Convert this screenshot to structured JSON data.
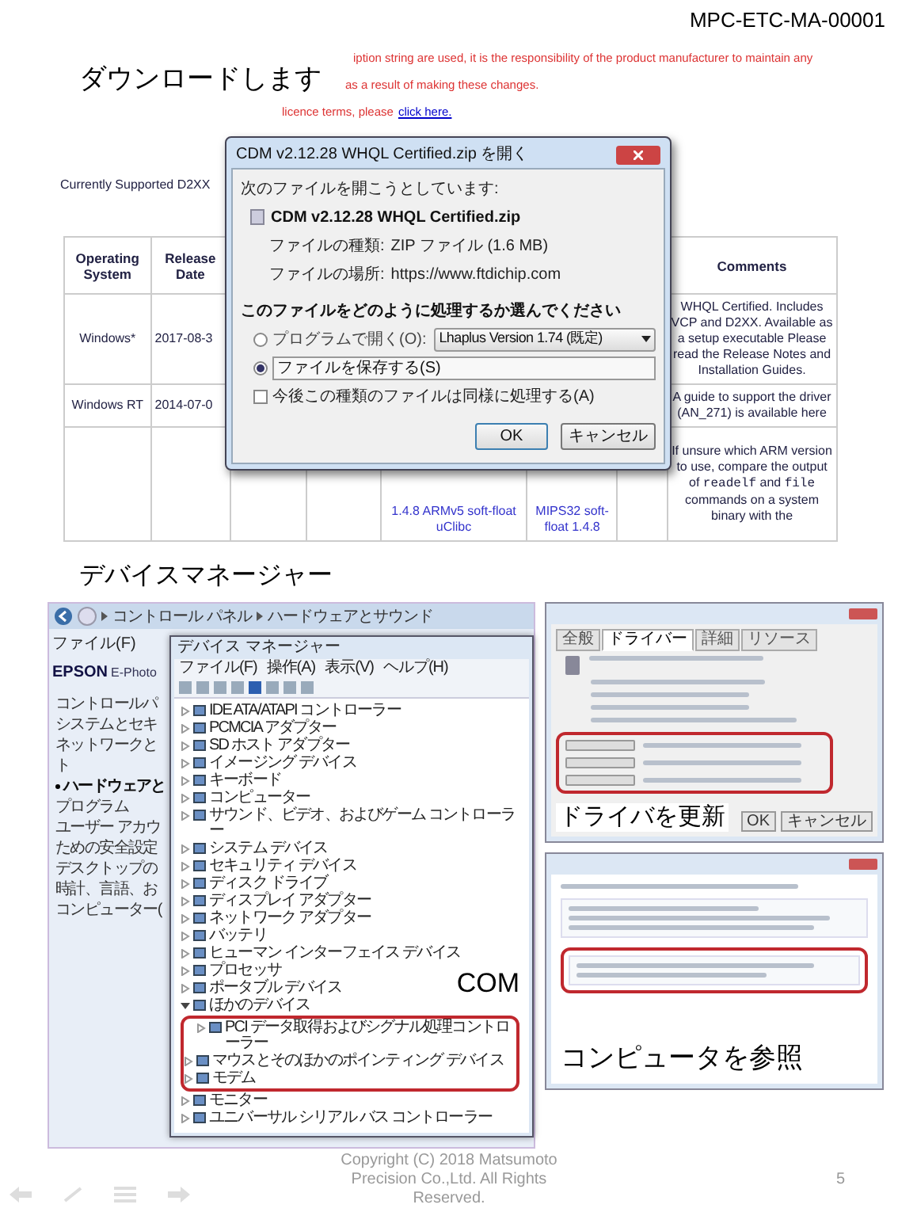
{
  "header": {
    "doc_id": "MPC-ETC-MA-00001"
  },
  "download_section": {
    "caption": "ダウンロードします",
    "web_page": {
      "notice_lines": [
        {
          "text": "iption string are used, it is the responsibility of the product manufacturer to maintain any"
        },
        {
          "text": "as a result of making these changes."
        },
        {
          "text": "licence terms, please",
          "link": "click here."
        }
      ],
      "heading": "Currently Supported D2XX",
      "table": {
        "columns": [
          "Operating System",
          "Release Date",
          null,
          null,
          null,
          null,
          null,
          "Comments"
        ],
        "rows": [
          {
            "cells": [
              "Windows*",
              "2017-08-3",
              null,
              null,
              null,
              null,
              null,
              [
                {
                  "text": "WHQL Certified. Includes VCP and D2XX. Available as a setup executable Please read the Release Notes and Installation Guides."
                }
              ]
            ]
          },
          {
            "cells": [
              "Windows RT",
              "2014-07-0",
              null,
              null,
              null,
              null,
              null,
              [
                {
                  "text": "A guide to support the driver (AN_271) is available here"
                }
              ]
            ]
          },
          {
            "cells": [
              null,
              null,
              null,
              null,
              "1.4.8 ARMv5 soft-float uClibc",
              "MIPS32 soft-float 1.4.8",
              null,
              [
                {
                  "text": "If unsure which ARM version to use, compare the output of "
                },
                {
                  "text": "readelf",
                  "code": true
                },
                {
                  "text": " and "
                },
                {
                  "text": "file",
                  "code": true
                },
                {
                  "text": " commands on a system binary with the"
                }
              ]
            ]
          }
        ]
      }
    },
    "dialog": {
      "title": "CDM v2.12.28 WHQL Certified.zip を開く",
      "intro": "次のファイルを開こうとしています:",
      "file_name": "CDM v2.12.28 WHQL Certified.zip",
      "file_type_label": "ファイルの種類:",
      "file_type": "ZIP ファイル (1.6 MB)",
      "source_label": "ファイルの場所:",
      "source": "https://www.ftdichip.com",
      "question": "このファイルをどのように処理するか選んでください",
      "options": [
        {
          "kind": "open_with",
          "label": "プログラムで開く(O):",
          "selected": false,
          "program": "Lhaplus Version 1.74 (既定)"
        },
        {
          "kind": "save",
          "label": "ファイルを保存する(S)",
          "selected": true
        }
      ],
      "remember": {
        "label": "今後この種類のファイルは同様に処理する(A)",
        "checked": false
      },
      "buttons": [
        "OK",
        "キャンセル"
      ]
    }
  },
  "device_section": {
    "caption": "デバイスマネージャー",
    "explorer": {
      "path": [
        "コントロール パネル",
        "ハードウェアとサウンド"
      ],
      "menu": "ファイル(F)",
      "brand": "EPSON",
      "brand_sub": "E-Photo",
      "sidebar": [
        {
          "text": "コントロールパ",
          "selected": false
        },
        {
          "text": "システムとセキ",
          "selected": false
        },
        {
          "text": "ネットワークと",
          "selected": false
        },
        {
          "text": "ト",
          "selected": false
        },
        {
          "text": "ハードウェアと",
          "selected": true
        },
        {
          "text": "プログラム",
          "selected": false
        },
        {
          "text": "ユーザー アカウ",
          "selected": false
        },
        {
          "text": "ための安全設定",
          "selected": false
        },
        {
          "text": "デスクトップの",
          "selected": false
        },
        {
          "text": "時計、言語、お",
          "selected": false
        },
        {
          "text": "コンピューター(",
          "selected": false
        }
      ]
    },
    "device_manager": {
      "title": "デバイス マネージャー",
      "menus": [
        "ファイル(F)",
        "操作(A)",
        "表示(V)",
        "ヘルプ(H)"
      ],
      "tree": [
        {
          "label": "IDE ATA/ATAPI コントローラー",
          "expanded": false
        },
        {
          "label": "PCMCIA アダプター",
          "expanded": false
        },
        {
          "label": "SD ホスト アダプター",
          "expanded": false
        },
        {
          "label": "イメージング デバイス",
          "expanded": false
        },
        {
          "label": "キーボード",
          "expanded": false
        },
        {
          "label": "コンピューター",
          "expanded": false
        },
        {
          "label": "サウンド、ビデオ、およびゲーム コントローラー",
          "expanded": false
        },
        {
          "label": "システム デバイス",
          "expanded": false
        },
        {
          "label": "セキュリティ デバイス",
          "expanded": false
        },
        {
          "label": "ディスク ドライブ",
          "expanded": false
        },
        {
          "label": "ディスプレイ アダプター",
          "expanded": false
        },
        {
          "label": "ネットワーク アダプター",
          "expanded": false
        },
        {
          "label": "バッテリ",
          "expanded": false
        },
        {
          "label": "ヒューマン インターフェイス デバイス",
          "expanded": false
        },
        {
          "label": "プロセッサ",
          "expanded": false
        },
        {
          "label": "ポータブル デバイス",
          "expanded": false
        },
        {
          "label": "ほかのデバイス",
          "expanded": true,
          "children": [
            {
              "label": "PCI データ取得およびシグナル処理コントローラー",
              "expanded": false
            }
          ]
        },
        {
          "label": "マウスとそのほかのポインティング デバイス",
          "expanded": false
        },
        {
          "label": "モデム",
          "expanded": false
        },
        {
          "label": "モニター",
          "expanded": false
        },
        {
          "label": "ユニバーサル シリアル バス コントローラー",
          "expanded": false
        }
      ]
    },
    "com_label": "COM"
  },
  "properties_dialog": {
    "tabs": [
      {
        "label": "全般",
        "selected": false
      },
      {
        "label": "ドライバー",
        "selected": true
      },
      {
        "label": "詳細",
        "selected": false
      },
      {
        "label": "リソース",
        "selected": false
      }
    ],
    "buttons": [
      "OK",
      "キャンセル"
    ],
    "caption": "ドライバを更新"
  },
  "update_dialog": {
    "caption": "コンピュータを参照"
  },
  "footer": {
    "copyright": "Copyright (C) 2018 Matsumoto Precision Co.,Ltd. All Rights Reserved.",
    "page": "5"
  }
}
